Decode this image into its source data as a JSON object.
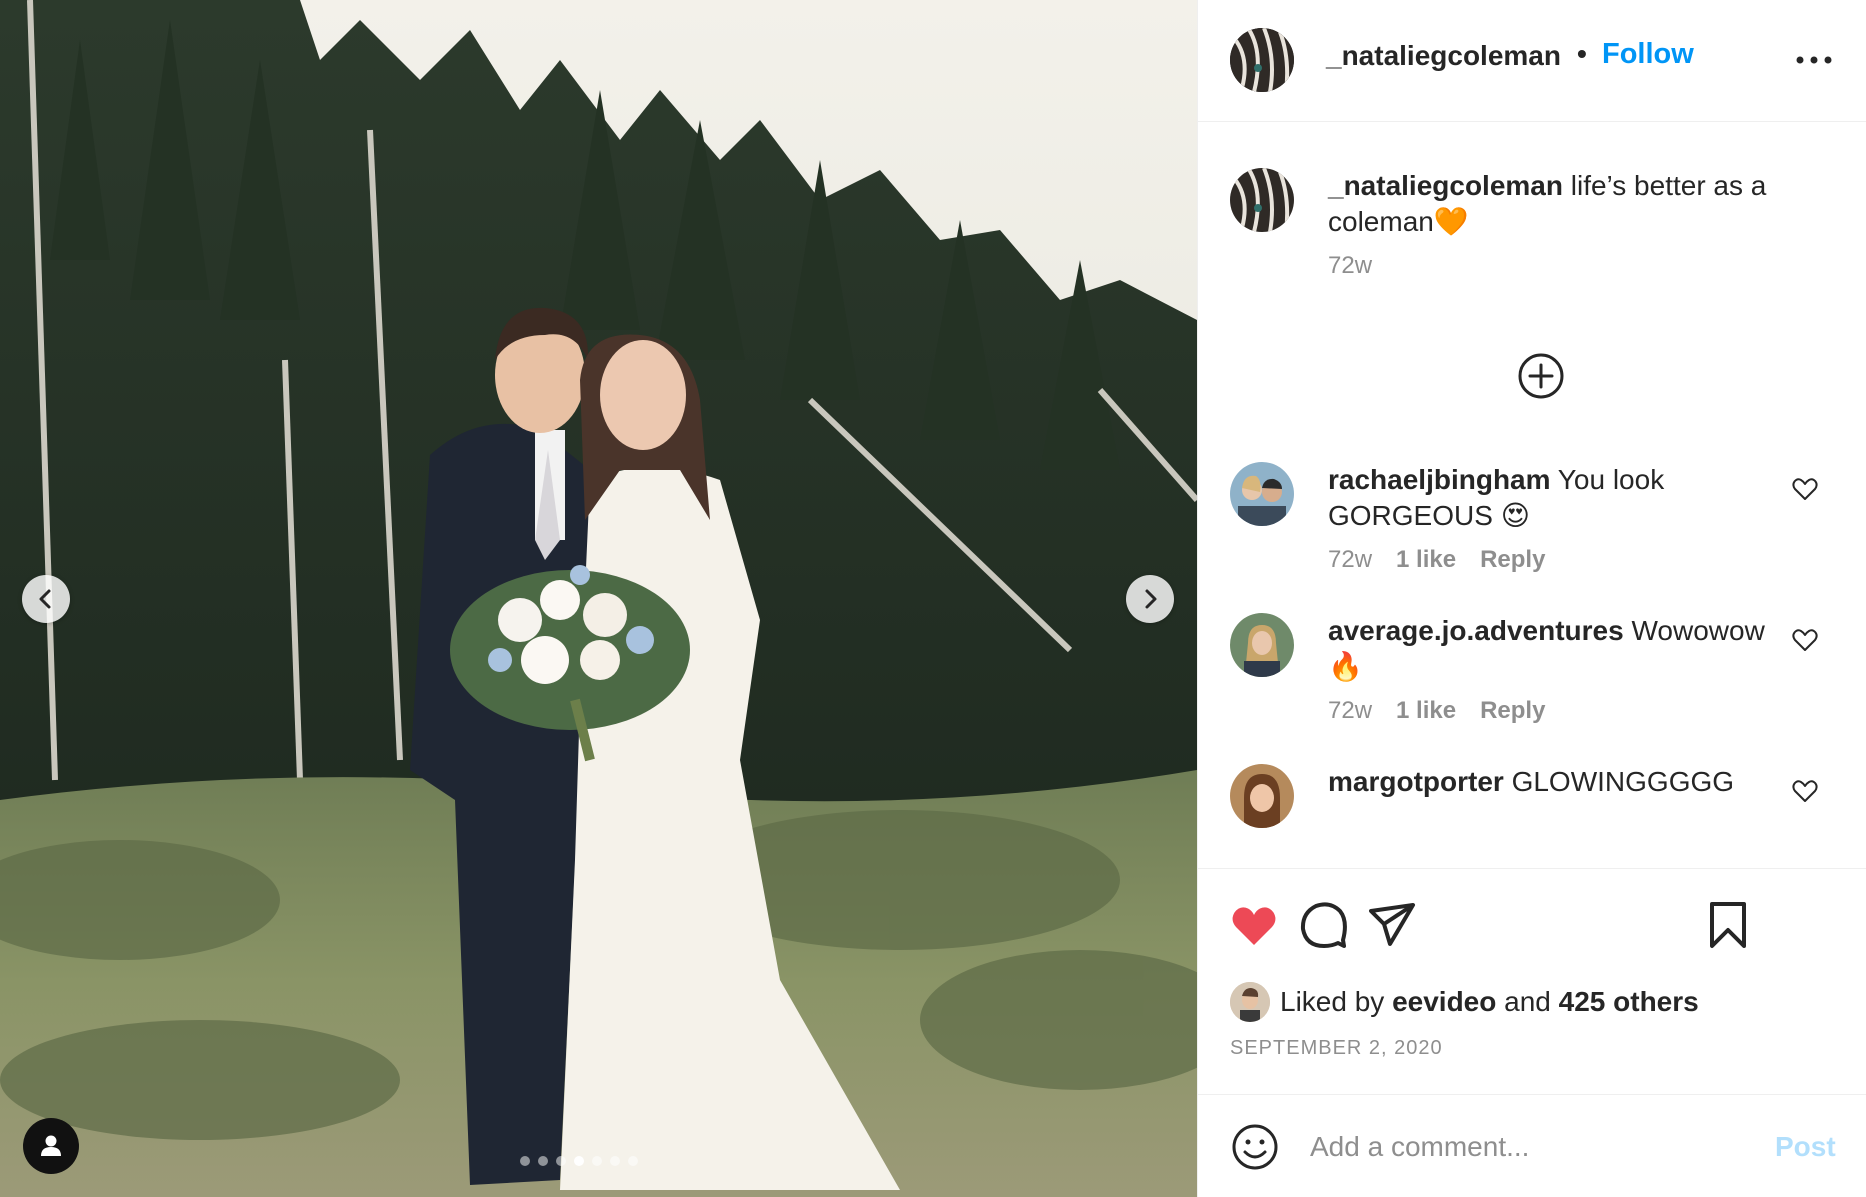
{
  "post": {
    "owner": {
      "username": "_nataliegcoleman",
      "separator": "•",
      "follow_label": "Follow",
      "more_icon": "more-icon"
    },
    "caption": {
      "username": "_nataliegcoleman",
      "text": "life’s better as a coleman🧡",
      "age": "72w"
    },
    "load_more_icon": "plus-circle-icon",
    "comments": [
      {
        "username": "rachaeljbingham",
        "text": "You look GORGEOUS 😍",
        "age": "72w",
        "likes": "1 like",
        "reply_label": "Reply"
      },
      {
        "username": "average.jo.adventures",
        "text": "Wowowow 🔥",
        "age": "72w",
        "likes": "1 like",
        "reply_label": "Reply"
      },
      {
        "username": "margotporter",
        "text": "GLOWINGGGGG"
      }
    ],
    "actions": {
      "liked": true,
      "like_color": "#ed4956",
      "icons": [
        "heart-icon",
        "comment-icon",
        "share-icon",
        "bookmark-icon"
      ]
    },
    "likes": {
      "prefix": "Liked by",
      "user": "eevideo",
      "connector": "and",
      "others": "425 others"
    },
    "date": "SEPTEMBER 2, 2020",
    "composer": {
      "placeholder": "Add a comment...",
      "post_label": "Post"
    },
    "carousel": {
      "slide_count": 7,
      "active_index": 3
    },
    "colors": {
      "accent": "#0095f6",
      "muted": "#8e8e8e",
      "post_disabled": "#b2dffc"
    }
  }
}
